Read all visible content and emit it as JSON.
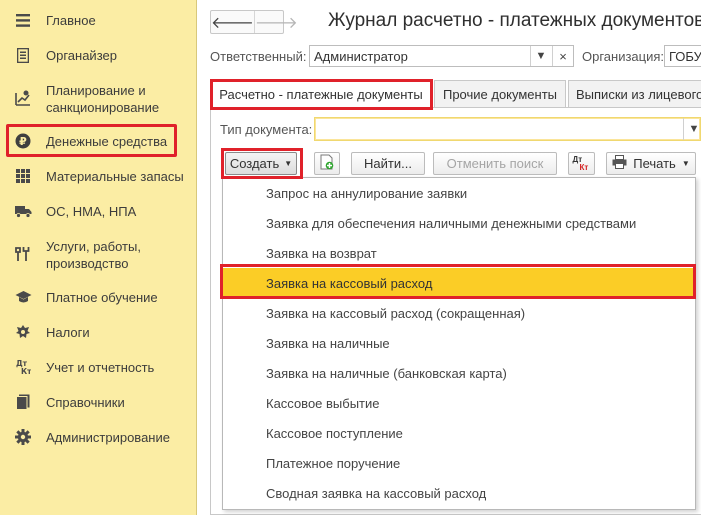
{
  "sidebar": {
    "items": [
      {
        "label": "Главное",
        "icon": "menu-icon"
      },
      {
        "label": "Органайзер",
        "icon": "notebook-icon"
      },
      {
        "label": "Планирование и санкционирование",
        "line1": "Планирование и",
        "line2": "санкционирование",
        "icon": "planning-icon"
      },
      {
        "label": "Денежные средства",
        "icon": "ruble-icon"
      },
      {
        "label": "Материальные запасы",
        "icon": "grid-icon"
      },
      {
        "label": "ОС, НМА, НПА",
        "icon": "truck-icon"
      },
      {
        "label": "Услуги, работы, производство",
        "line1": "Услуги, работы,",
        "line2": "производство",
        "icon": "tools-icon"
      },
      {
        "label": "Платное обучение",
        "icon": "graduation-cap-icon"
      },
      {
        "label": "Налоги",
        "icon": "emblem-icon"
      },
      {
        "label": "Учет и отчетность",
        "icon": "debit-credit-icon"
      },
      {
        "label": "Справочники",
        "icon": "books-icon"
      },
      {
        "label": "Администрирование",
        "icon": "gear-icon"
      }
    ]
  },
  "header": {
    "title": "Журнал расчетно - платежных документов",
    "back_symbol": "🡐",
    "forward_symbol": "🡒"
  },
  "filters": {
    "responsible_label": "Ответственный:",
    "responsible_value": "Администратор",
    "organization_label": "Организация:",
    "organization_value": "ГОБУ",
    "doc_type_label": "Тип документа:",
    "doc_type_value": ""
  },
  "tabs": [
    {
      "label": "Расчетно - платежные документы",
      "active": true
    },
    {
      "label": "Прочие документы",
      "active": false
    },
    {
      "label": "Выписки из лицевого",
      "active": false
    }
  ],
  "toolbar": {
    "create_label": "Создать",
    "find_label": "Найти...",
    "cancel_search_label": "Отменить поиск",
    "print_label": "Печать",
    "dt_kt_label_top": "Дт",
    "dt_kt_label_bottom": "Кт"
  },
  "create_menu": {
    "items": [
      "Запрос на аннулирование заявки",
      "Заявка для обеспечения наличными денежными средствами",
      "Заявка на возврат",
      "Заявка на кассовый расход",
      "Заявка на кассовый расход (сокращенная)",
      "Заявка на наличные",
      "Заявка на наличные (банковская карта)",
      "Кассовое выбытие",
      "Кассовое поступление",
      "Платежное поручение",
      "Сводная заявка на кассовый расход"
    ],
    "selected": "Заявка на кассовый расход"
  },
  "colors": {
    "sidebar_bg": "#fbeda4",
    "highlight_red": "#e0212a",
    "selected_item": "#fbcd26"
  }
}
